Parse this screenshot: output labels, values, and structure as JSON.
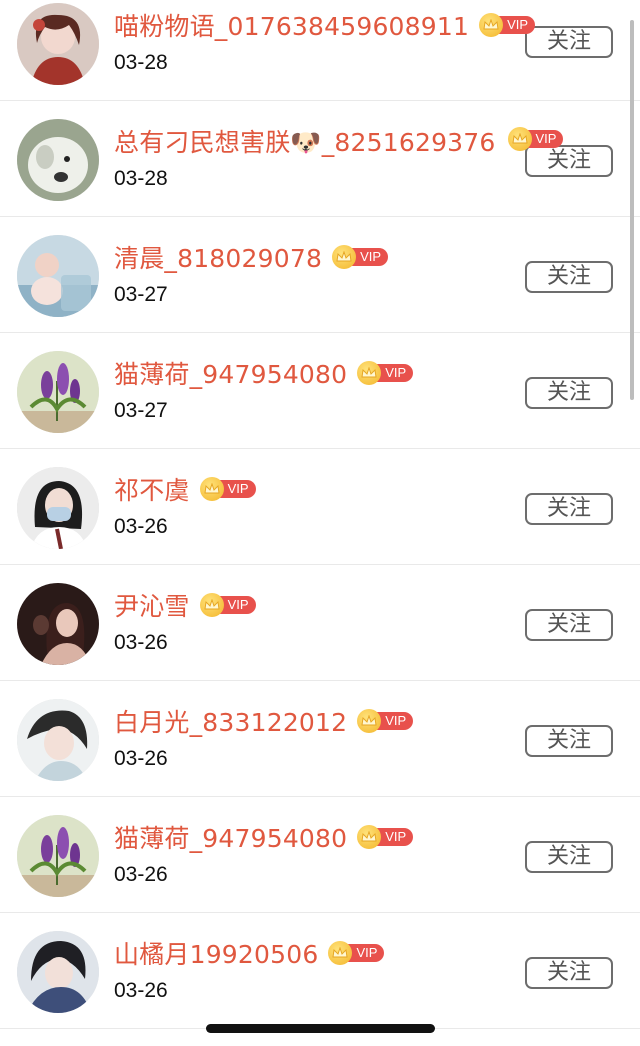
{
  "list": {
    "items": [
      {
        "name": "喵粉物语_017638459608911",
        "date": "03-28",
        "vip": "VIP",
        "follow": "关注",
        "avatar": "avatar-girl-red"
      },
      {
        "name": "总有刁民想害朕🐶_8251629376",
        "date": "03-28",
        "vip": "VIP",
        "follow": "关注",
        "avatar": "avatar-puppy"
      },
      {
        "name": "清晨_818029078",
        "date": "03-27",
        "vip": "VIP",
        "follow": "关注",
        "avatar": "avatar-baby"
      },
      {
        "name": "猫薄荷_947954080",
        "date": "03-27",
        "vip": "VIP",
        "follow": "关注",
        "avatar": "avatar-flowers"
      },
      {
        "name": "祁不虞",
        "date": "03-26",
        "vip": "VIP",
        "follow": "关注",
        "avatar": "avatar-masked-girl"
      },
      {
        "name": "尹沁雪",
        "date": "03-26",
        "vip": "VIP",
        "follow": "关注",
        "avatar": "avatar-dark-portrait"
      },
      {
        "name": "白月光_833122012",
        "date": "03-26",
        "vip": "VIP",
        "follow": "关注",
        "avatar": "avatar-girl-light"
      },
      {
        "name": "猫薄荷_947954080",
        "date": "03-26",
        "vip": "VIP",
        "follow": "关注",
        "avatar": "avatar-flowers"
      },
      {
        "name": "山橘月19920506",
        "date": "03-26",
        "vip": "VIP",
        "follow": "关注",
        "avatar": "avatar-girl-blue"
      }
    ]
  },
  "icons": {
    "vip_badge": "crown-icon"
  },
  "colors": {
    "name": "#e0583f",
    "vip_pill": "#e8514c",
    "crown": "#f3b52a",
    "follow_border": "#6d6d6d"
  }
}
